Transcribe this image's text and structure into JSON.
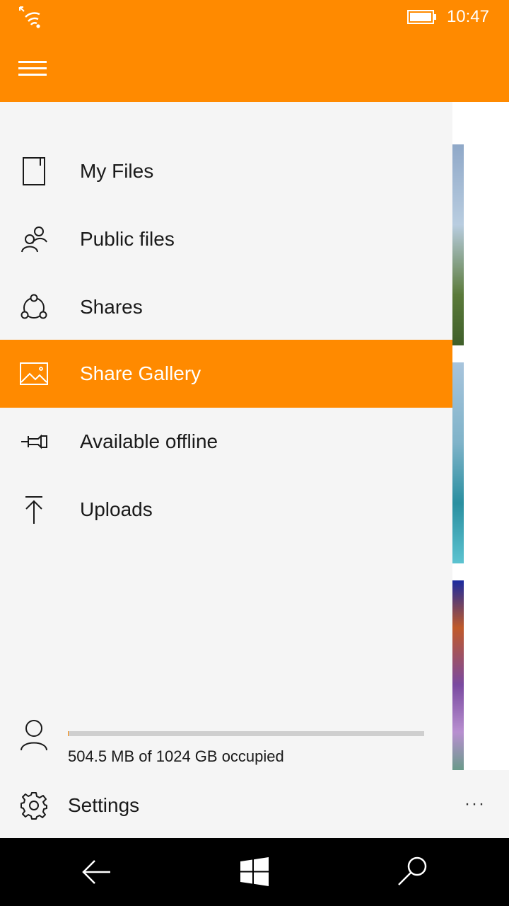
{
  "status": {
    "time": "10:47",
    "icons": [
      "wifi-signal-icon",
      "battery-icon"
    ]
  },
  "header": {
    "menu_icon": "hamburger-icon"
  },
  "drawer": {
    "items": [
      {
        "label": "My Files",
        "icon": "file-icon",
        "selected": false
      },
      {
        "label": "Public files",
        "icon": "people-icon",
        "selected": false
      },
      {
        "label": "Shares",
        "icon": "share-icon",
        "selected": false
      },
      {
        "label": "Share Gallery",
        "icon": "picture-icon",
        "selected": true
      },
      {
        "label": "Available offline",
        "icon": "pin-icon",
        "selected": false
      },
      {
        "label": "Uploads",
        "icon": "upload-icon",
        "selected": false
      }
    ],
    "account": {
      "icon": "user-icon",
      "storage_text": "504.5 MB of 1024 GB occupied",
      "storage_used_fraction": 0.0005
    },
    "settings_label": "Settings",
    "more_label": "···"
  },
  "navbar": {
    "icons": [
      "back-arrow-icon",
      "windows-logo-icon",
      "search-icon"
    ]
  },
  "colors": {
    "accent": "#FF8A00",
    "drawer_bg": "#f5f5f5",
    "text": "#1a1a1a"
  }
}
